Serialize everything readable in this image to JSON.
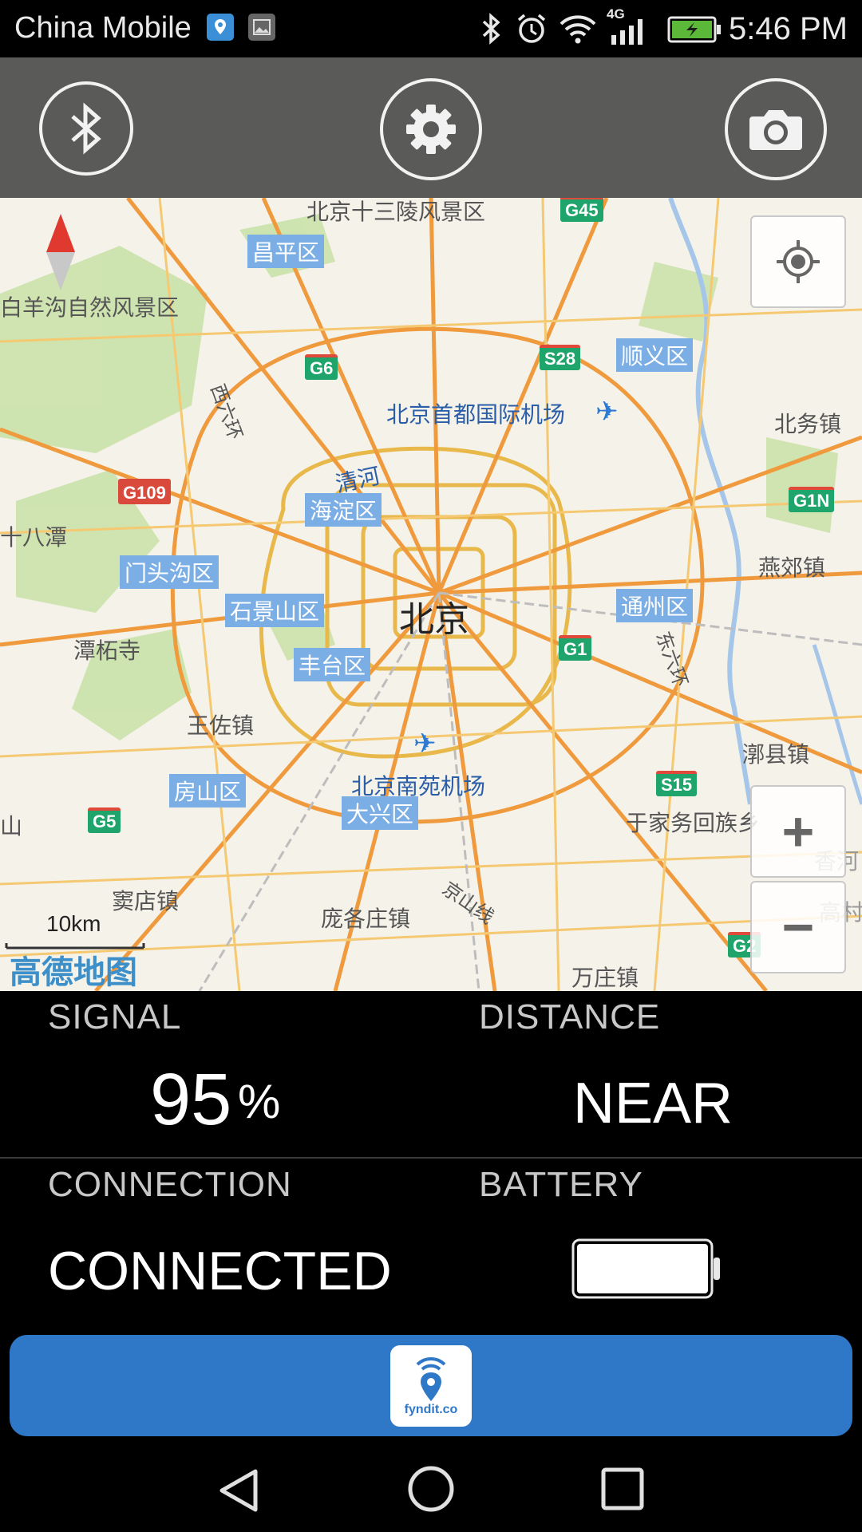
{
  "status_bar": {
    "carrier": "China Mobile",
    "network": "4G",
    "time": "5:46 PM",
    "icons": [
      "location-pin-icon",
      "gallery-icon",
      "bluetooth-icon",
      "alarm-icon",
      "wifi-icon",
      "signal-bars-icon",
      "battery-charging-icon"
    ]
  },
  "toolbar": {
    "buttons": [
      "bluetooth-icon",
      "settings-gear-icon",
      "camera-icon"
    ]
  },
  "map": {
    "compass_icon": "compass-icon",
    "scale": "10km",
    "provider_logo": "高德地图",
    "labels": {
      "ming_tombs": "北京十三陵风景区",
      "baiyanggou": "白羊沟自然风景区",
      "shibadu": "十八潭",
      "tanzhe": "潭柘寺",
      "wangzuo": "王佐镇",
      "doudian": "窦店镇",
      "pangezhuang": "庞各庄镇",
      "wanzhuang": "万庄镇",
      "yujiawu": "于家务回族乡",
      "yongle": "漷县镇",
      "yanjiao": "燕郊镇",
      "beiwu": "北务镇",
      "capital_airport": "北京首都国际机场",
      "nanyuan_airport": "北京南苑机场",
      "qinghe": "清河",
      "beijing": "北京",
      "xiliuhuan": "西六环",
      "dongliuhuan": "东六环",
      "jingshan": "京山线",
      "xianghe": "香河",
      "gaocun": "高村",
      "shan": "山"
    },
    "districts": {
      "changping": "昌平区",
      "shunyi": "顺义区",
      "haidian": "海淀区",
      "mentougou": "门头沟区",
      "shijingshan": "石景山区",
      "fengtai": "丰台区",
      "tongzhou": "通州区",
      "fangshan": "房山区",
      "daxing": "大兴区"
    },
    "highways": {
      "g45": "G45",
      "g6": "G6",
      "s28": "S28",
      "g109": "G109",
      "g1": "G1",
      "g1n": "G1N",
      "s15": "S15",
      "g5": "G5",
      "g2": "G2"
    },
    "controls": {
      "locate_icon": "crosshair-locate-icon",
      "zoom_in": "+",
      "zoom_out": "−"
    }
  },
  "info": {
    "signal_label": "SIGNAL",
    "signal_value": "95",
    "signal_unit": "%",
    "distance_label": "DISTANCE",
    "distance_value": "NEAR",
    "connection_label": "CONNECTION",
    "connection_value": "CONNECTED",
    "battery_label": "BATTERY",
    "battery_level": 1.0
  },
  "banner": {
    "logo_text": "fyndit.co"
  },
  "nav_bar": {
    "buttons": [
      "back-icon",
      "home-icon",
      "recents-icon"
    ]
  }
}
